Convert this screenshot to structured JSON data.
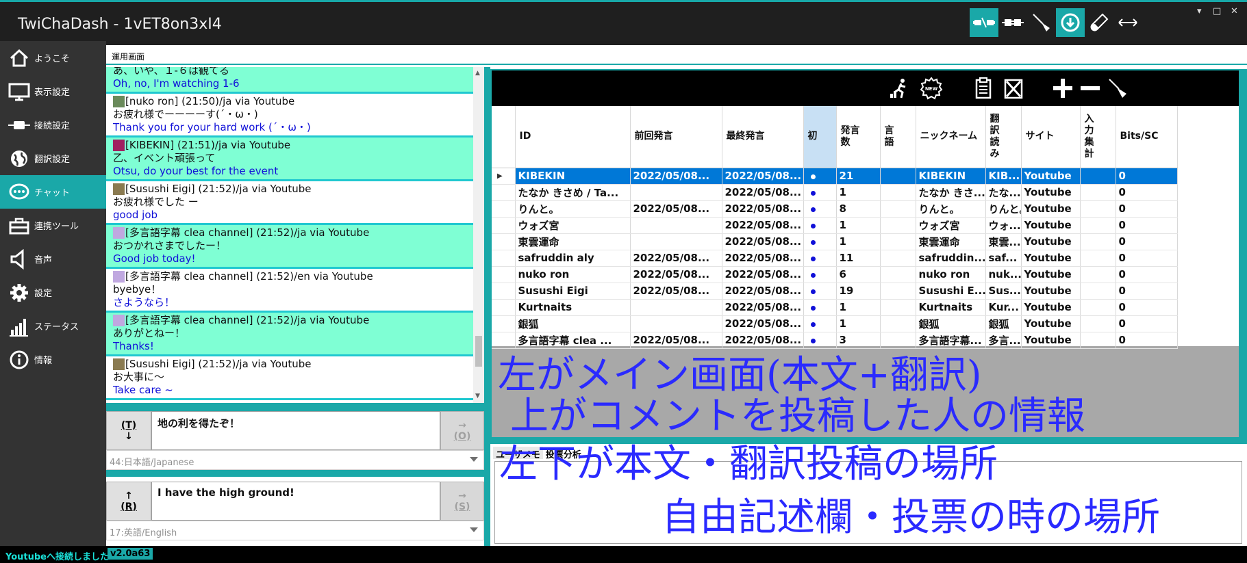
{
  "window": {
    "title": "TwiChaDash - 1vET8on3xI4",
    "minimize": "▾",
    "maximize": "□",
    "close": "✕"
  },
  "toolbar_icons": [
    "disconnect-icon",
    "plug-icon",
    "broom-icon",
    "download-icon",
    "test-tube-icon",
    "resize-horizontal-icon"
  ],
  "sidebar": {
    "items": [
      {
        "label": "ようこそ",
        "icon": "home-icon"
      },
      {
        "label": "表示設定",
        "icon": "monitor-icon"
      },
      {
        "label": "接続設定",
        "icon": "plug-icon"
      },
      {
        "label": "翻訳設定",
        "icon": "globe-icon"
      },
      {
        "label": "チャット",
        "icon": "chat-icon",
        "active": true
      },
      {
        "label": "連携ツール",
        "icon": "toolbox-icon"
      },
      {
        "label": "音声",
        "icon": "speaker-icon"
      },
      {
        "label": "設定",
        "icon": "gear-icon"
      },
      {
        "label": "ステータス",
        "icon": "signal-bars-icon"
      },
      {
        "label": "情報",
        "icon": "info-icon"
      }
    ]
  },
  "tab": {
    "label": "運用画面"
  },
  "chat": {
    "messages": [
      {
        "header": "",
        "orig": "あ、いや、１-６は観てる",
        "trans": "Oh, no, I'm watching 1-6",
        "highlight": true
      },
      {
        "header": "[nuko ron] (21:50)/ja via Youtube",
        "orig": "お疲れ様でーーーーす(´・ω・)",
        "trans": "Thank you for your hard work (´・ω・)",
        "highlight": false
      },
      {
        "header": "[KIBEKIN] (21:51)/ja via Youtube",
        "orig": "乙、イベント頑張って",
        "trans": "Otsu, do your best for the event",
        "highlight": true
      },
      {
        "header": "[Susushi Eigi] (21:52)/ja via Youtube",
        "orig": "お疲れ様でした ー",
        "trans": "good job",
        "highlight": false
      },
      {
        "header": "[多言語字幕 clea channel] (21:52)/ja via Youtube",
        "orig": "おつかれさまでしたー！",
        "trans": "Good job today!",
        "highlight": true
      },
      {
        "header": "[多言語字幕 clea channel] (21:52)/en via Youtube",
        "orig": "byebye！",
        "trans": "さようなら！",
        "highlight": false
      },
      {
        "header": "[多言語字幕 clea channel] (21:52)/ja via Youtube",
        "orig": "ありがとねー！",
        "trans": "Thanks!",
        "highlight": true
      },
      {
        "header": "[Susushi Eigi] (21:52)/ja via Youtube",
        "orig": "お大事に〜",
        "trans": "Take care ~",
        "highlight": false
      }
    ]
  },
  "input1": {
    "left_key": "(T)",
    "left_arrow": "↓",
    "text": "地の利を得たぞ！",
    "right_arrow": "→",
    "right_key": "(O)",
    "lang": "44:日本語/Japanese"
  },
  "input2": {
    "left_arrow": "↑",
    "left_key": "(R)",
    "text": "I have the high ground!",
    "right_arrow": "→",
    "right_key": "(S)",
    "lang": "17:英語/English"
  },
  "grid": {
    "toolbar_icons": [
      "runner-icon",
      "new-badge-icon",
      "clipboard-icon",
      "clear-list-icon",
      "plus-icon",
      "minus-icon",
      "broom-icon"
    ],
    "columns": [
      "ID",
      "前回発言",
      "最終発言",
      "初",
      "発言\n数",
      "言\n語",
      "ニックネーム",
      "翻\n訳\n読\nみ",
      "サイト",
      "入\n力\n集\n計",
      "Bits/SC"
    ],
    "rows": [
      [
        "KIBEKIN",
        "2022/05/08...",
        "2022/05/08...",
        "●",
        "21",
        "",
        "KIBEKIN",
        "KIB...",
        "Youtube",
        "",
        "0"
      ],
      [
        "たなか きさめ / Ta...",
        "",
        "2022/05/08...",
        "●",
        "1",
        "",
        "たなか きさ...",
        "たな...",
        "Youtube",
        "",
        "0"
      ],
      [
        "りんと。",
        "2022/05/08...",
        "2022/05/08...",
        "●",
        "8",
        "",
        "りんと。",
        "りんと。",
        "Youtube",
        "",
        "0"
      ],
      [
        "ウォズ宮",
        "",
        "2022/05/08...",
        "●",
        "1",
        "",
        "ウォズ宮",
        "ウォ...",
        "Youtube",
        "",
        "0"
      ],
      [
        "東雲運命",
        "",
        "2022/05/08...",
        "●",
        "1",
        "",
        "東雲運命",
        "東雲...",
        "Youtube",
        "",
        "0"
      ],
      [
        "safruddin aly",
        "2022/05/08...",
        "2022/05/08...",
        "●",
        "11",
        "",
        "safruddin...",
        "saf...",
        "Youtube",
        "",
        "0"
      ],
      [
        "nuko ron",
        "2022/05/08...",
        "2022/05/08...",
        "●",
        "6",
        "",
        "nuko ron",
        "nuk...",
        "Youtube",
        "",
        "0"
      ],
      [
        "Susushi Eigi",
        "2022/05/08...",
        "2022/05/08...",
        "●",
        "19",
        "",
        "Susushi E...",
        "Sus...",
        "Youtube",
        "",
        "0"
      ],
      [
        "Kurtnaits",
        "",
        "2022/05/08...",
        "●",
        "1",
        "",
        "Kurtnaits",
        "Kur...",
        "Youtube",
        "",
        "0"
      ],
      [
        "銀狐",
        "",
        "2022/05/08...",
        "●",
        "1",
        "",
        "銀狐",
        "銀狐",
        "Youtube",
        "",
        "0"
      ],
      [
        "多言語字幕 clea ...",
        "2022/05/08...",
        "2022/05/08...",
        "●",
        "3",
        "",
        "多言語字幕...",
        "多言...",
        "Youtube",
        "",
        "0"
      ]
    ]
  },
  "memo": {
    "tabs": [
      "ユーザメモ",
      "投票分析"
    ]
  },
  "overlay": {
    "line1": "左がメイン画面(本文+翻訳)",
    "line2": "上がコメントを投稿した人の情報",
    "line3": "左下が本文・翻訳投稿の場所",
    "line4": "自由記述欄・投票の時の場所"
  },
  "status": {
    "text": "Youtubeへ接続しました",
    "version": "v2.0a63"
  }
}
